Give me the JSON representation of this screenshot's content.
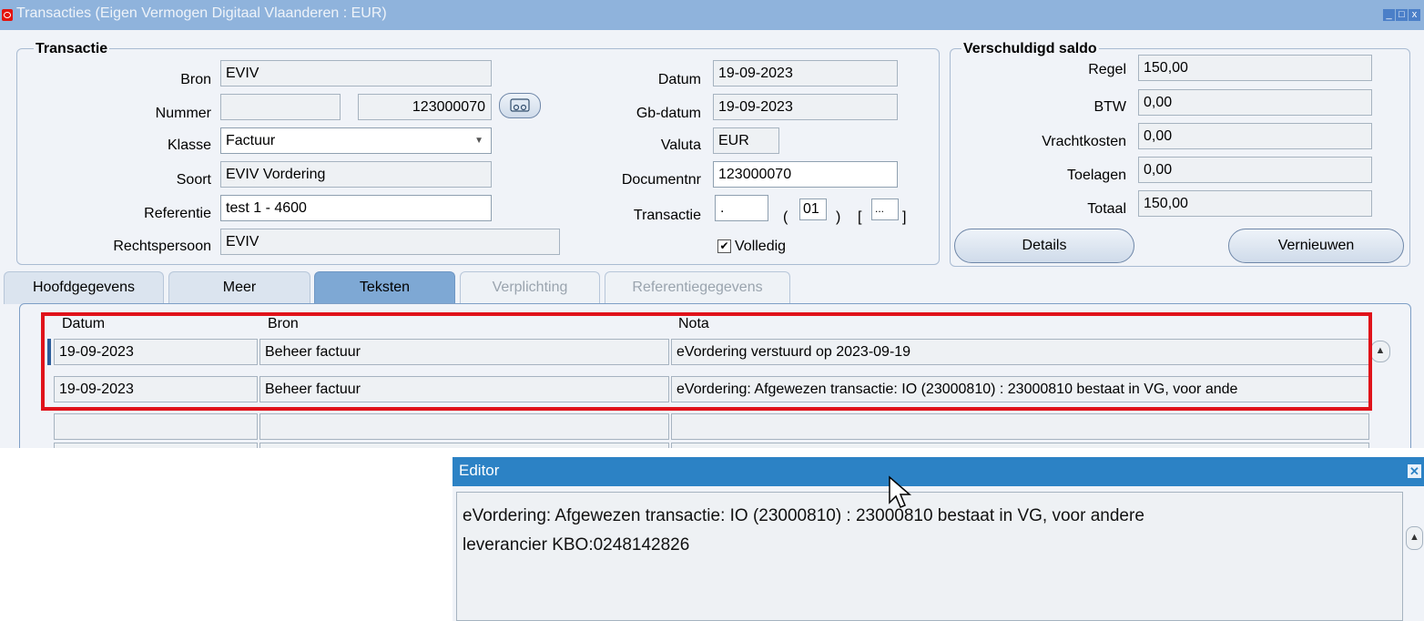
{
  "window": {
    "title": "Transacties (Eigen Vermogen Digitaal Vlaanderen : EUR)",
    "controls": [
      "_",
      "□",
      "x"
    ]
  },
  "transactie": {
    "group_title": "Transactie",
    "bron_label": "Bron",
    "bron_value": "EVIV",
    "nummer_label": "Nummer",
    "nummer_prefix": "",
    "nummer_value": "123000070",
    "klasse_label": "Klasse",
    "klasse_value": "Factuur",
    "soort_label": "Soort",
    "soort_value": "EVIV Vordering",
    "referentie_label": "Referentie",
    "referentie_value": "test 1 - 4600",
    "rechtspersoon_label": "Rechtspersoon",
    "rechtspersoon_value": "EVIV",
    "datum_label": "Datum",
    "datum_value": "19-09-2023",
    "gbdatum_label": "Gb-datum",
    "gbdatum_value": "19-09-2023",
    "valuta_label": "Valuta",
    "valuta_value": "EUR",
    "documentnr_label": "Documentnr",
    "documentnr_value": "123000070",
    "transactie_label": "Transactie",
    "transactie_value": ".",
    "transactie_paren_open": "(",
    "transactie_code": "01",
    "transactie_paren_close": ")",
    "transactie_bracket_open": "[",
    "transactie_bracket_value": "...",
    "transactie_bracket_close": "]",
    "volledig_label": "Volledig",
    "volledig_checked": true
  },
  "saldo": {
    "group_title": "Verschuldigd saldo",
    "regel_label": "Regel",
    "regel_value": "150,00",
    "btw_label": "BTW",
    "btw_value": "0,00",
    "vracht_label": "Vrachtkosten",
    "vracht_value": "0,00",
    "toelagen_label": "Toelagen",
    "toelagen_value": "0,00",
    "totaal_label": "Totaal",
    "totaal_value": "150,00",
    "details_button": "Details",
    "vernieuwen_button": "Vernieuwen"
  },
  "tabs": [
    {
      "label": "Hoofdgegevens",
      "state": "normal"
    },
    {
      "label": "Meer",
      "state": "normal"
    },
    {
      "label": "Teksten",
      "state": "active"
    },
    {
      "label": "Verplichting",
      "state": "disabled"
    },
    {
      "label": "Referentiegegevens",
      "state": "disabled"
    }
  ],
  "notes_table": {
    "headers": [
      "Datum",
      "Bron",
      "Nota"
    ],
    "rows": [
      [
        "19-09-2023",
        "Beheer factuur",
        "eVordering verstuurd op 2023-09-19"
      ],
      [
        "19-09-2023",
        "Beheer factuur",
        "eVordering: Afgewezen transactie: IO (23000810) : 23000810 bestaat in VG, voor ande"
      ],
      [
        "",
        "",
        ""
      ],
      [
        "",
        "",
        ""
      ]
    ],
    "highlight_color": "#e0121a"
  },
  "editor": {
    "title": "Editor",
    "line1": "eVordering: Afgewezen transactie: IO (23000810) : 23000810 bestaat in VG, voor andere",
    "line2": "leverancier KBO:0248142826"
  },
  "colors": {
    "titlebar": "#8fb3dc",
    "editor_titlebar": "#2c82c5",
    "active_tab": "#7ea8d4",
    "highlight": "#e0121a"
  }
}
